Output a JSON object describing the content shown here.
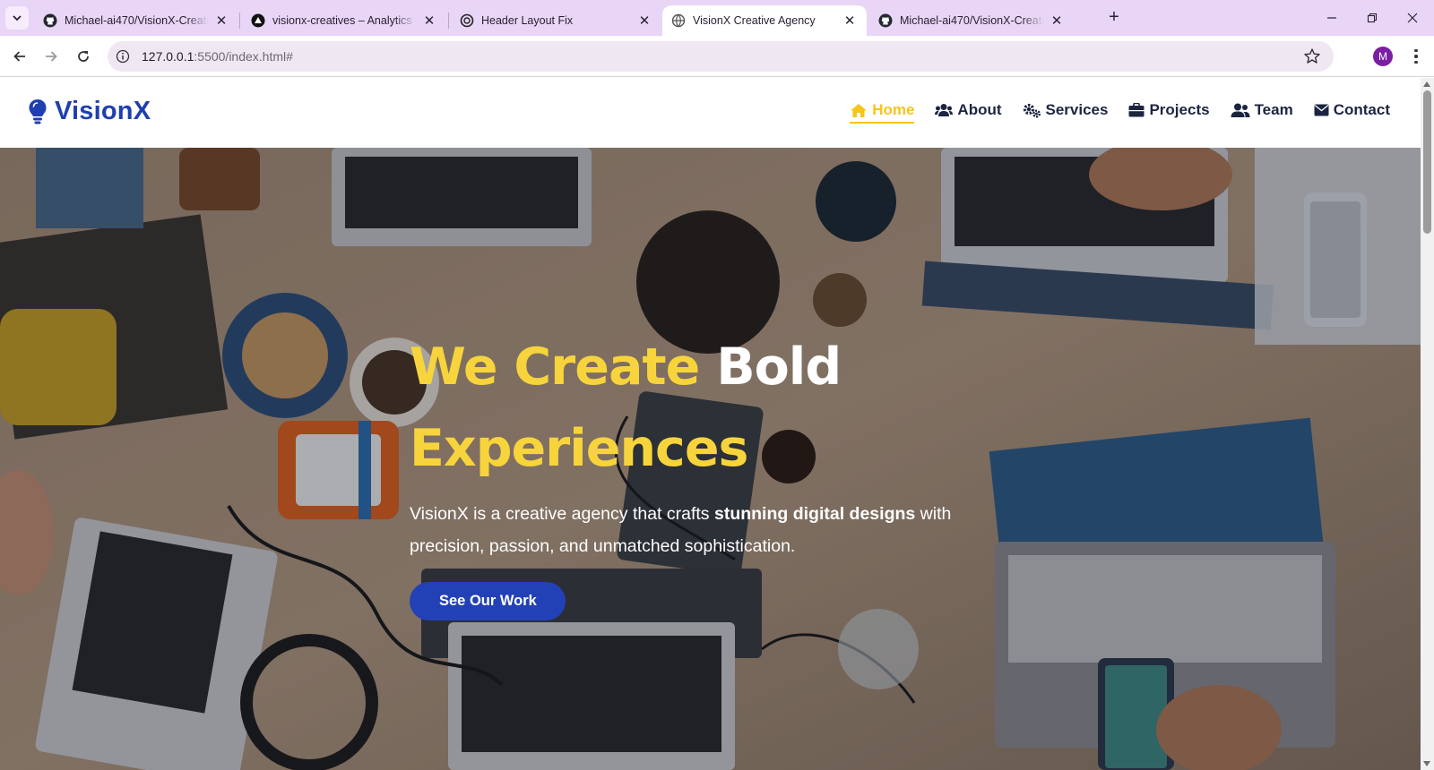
{
  "browser": {
    "tabs": [
      {
        "title": "Michael-ai470/VisionX-Creative",
        "icon": "github-icon"
      },
      {
        "title": "visionx-creatives – Analytics – V",
        "icon": "vercel-icon"
      },
      {
        "title": "Header Layout Fix",
        "icon": "chatgpt-icon"
      },
      {
        "title": "VisionX Creative Agency",
        "icon": "globe-icon"
      },
      {
        "title": "Michael-ai470/VisionX-Creative",
        "icon": "github-icon"
      }
    ],
    "active_tab": 3,
    "url_host": "127.0.0.1",
    "url_path": ":5500/index.html#",
    "profile_initial": "M"
  },
  "site": {
    "brand": "VisionX",
    "nav": [
      {
        "label": "Home",
        "icon": "home-icon",
        "active": true
      },
      {
        "label": "About",
        "icon": "users-icon"
      },
      {
        "label": "Services",
        "icon": "gears-icon"
      },
      {
        "label": "Projects",
        "icon": "briefcase-icon"
      },
      {
        "label": "Team",
        "icon": "user-group-icon"
      },
      {
        "label": "Contact",
        "icon": "envelope-icon"
      }
    ],
    "hero": {
      "title_part1": "We Create",
      "title_part2": "Bold",
      "title_part3": "Experiences",
      "text_a": "VisionX is a creative agency that crafts",
      "text_bold": "stunning digital designs",
      "text_b": "with precision, passion, and unmatched sophistication.",
      "cta": "See Our Work"
    }
  },
  "colors": {
    "brand_blue": "#1f3fb0",
    "accent_yellow": "#f7d43c",
    "cta_blue": "#2341b7",
    "tabbar_bg": "#e9d5f5"
  }
}
